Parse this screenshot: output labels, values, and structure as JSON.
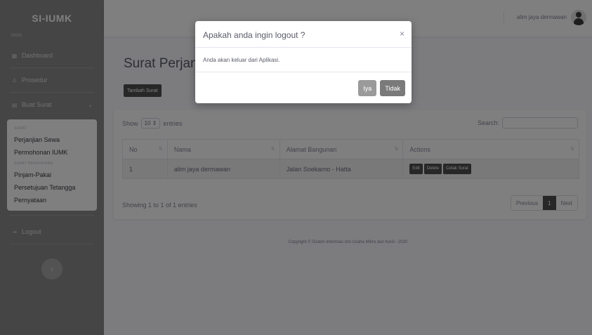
{
  "app": {
    "brand": "SI-IUMK"
  },
  "sidebar": {
    "heading": "MAIN",
    "items": [
      {
        "icon": "dashboard-icon",
        "label": "Dashboard"
      },
      {
        "icon": "user-icon",
        "label": "Prosedur"
      },
      {
        "icon": "folder-icon",
        "label": "Buat Surat"
      }
    ],
    "submenu": {
      "sections": [
        {
          "header": "SURAT",
          "items": [
            "Perjanjian Sewa",
            "Permohonan IUMK"
          ]
        },
        {
          "header": "SURAT PERNYATAAN",
          "items": [
            "Pinjam-Pakai",
            "Persetujuan Tetangga",
            "Pernyataan"
          ]
        }
      ]
    },
    "logout_label": "Logout"
  },
  "topbar": {
    "user_name": "alim jaya dermawan"
  },
  "main": {
    "title": "Surat Perjanji",
    "add_button": "Tambah Surat",
    "table": {
      "show_label": "Show",
      "page_size": "10",
      "entries_label": "entries",
      "search_label": "Search:",
      "columns": [
        "No",
        "Nama",
        "Alamat Bangunan",
        "Actions"
      ],
      "rows": [
        {
          "no": "1",
          "nama": "alim jaya dermawan",
          "alamat": "Jalan Soekarno - Hatta",
          "actions": [
            "Edit",
            "Delete",
            "Cetak Surat"
          ]
        }
      ],
      "showing": "Showing 1 to 1 of 1 entries",
      "pagination": {
        "previous": "Previous",
        "current": "1",
        "next": "Next"
      }
    },
    "footer": "Copyright © Sistem Informasi Izin Usaha Mikro dan Kecil - 2020"
  },
  "modal": {
    "title": "Apakah anda ingin logout ?",
    "close": "×",
    "body": "Anda akan keluar dari Aplikasi.",
    "confirm": "Iya",
    "cancel": "Tidak"
  }
}
